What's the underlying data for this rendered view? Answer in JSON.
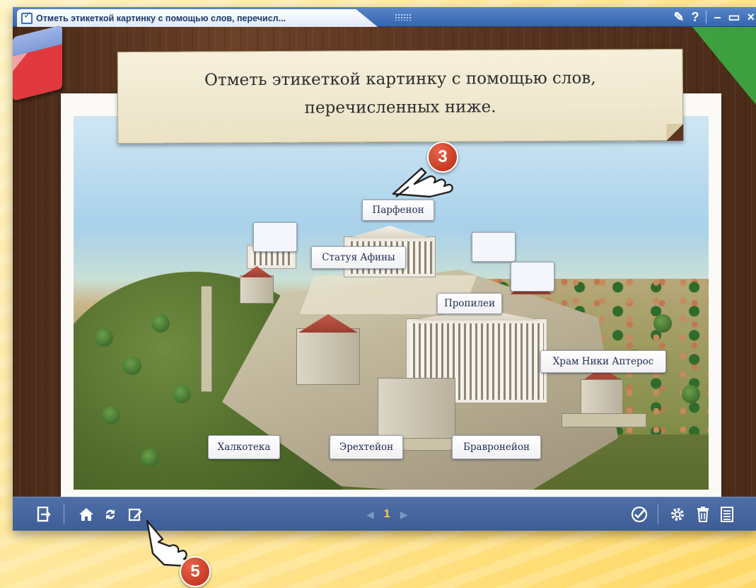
{
  "window": {
    "title": "Отметь этикеткой картинку с помощью слов, перечисл...",
    "controls": {
      "tool": "✎",
      "help": "?",
      "minimize": "–",
      "maximize": "▭",
      "close": "×"
    }
  },
  "instruction": {
    "line1": "Отметь этикеткой картинку с помощью слов,",
    "line2": "перечисленных ниже."
  },
  "labels": {
    "parthenon": "Парфенон",
    "athena_statue": "Статуя Афины",
    "propylaea": "Пропилеи",
    "nike_temple": "Храм Ники Аптерос",
    "chalkotheke": "Халкотека",
    "erechtheion": "Эрехтейон",
    "brauroneion": "Бравронейон"
  },
  "toolbar": {
    "page_number": "1",
    "icons": [
      "exit-icon",
      "home-icon",
      "reset-icon",
      "edit-icon",
      "check-icon",
      "settings-icon",
      "delete-icon",
      "menu-icon"
    ]
  },
  "callouts": {
    "top": "3",
    "bottom": "5"
  },
  "colors": {
    "titlebar": "#3465b1",
    "toolbar": "#4562a0",
    "callout": "#c8371d",
    "page_number": "#ffd23a",
    "label_text": "#1f2a52"
  }
}
